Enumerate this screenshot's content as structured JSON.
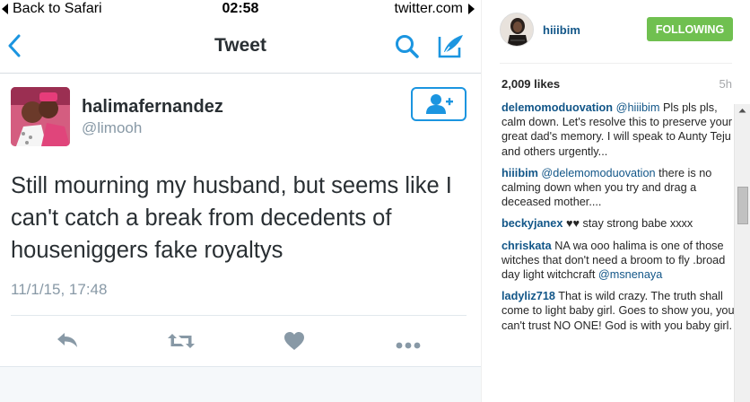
{
  "status_bar": {
    "back_label": "Back to Safari",
    "time": "02:58",
    "site": "twitter.com"
  },
  "nav": {
    "title": "Tweet",
    "back_icon": "chevron-left-icon",
    "search_icon": "search-icon",
    "compose_icon": "compose-icon"
  },
  "tweet": {
    "display_name": "halimafernandez",
    "handle": "@limooh",
    "text": "Still mourning my husband, but seems like I can't catch a break from decedents of houseniggers fake royaltys",
    "date": "11/1/15, 17:48",
    "follow_icon": "add-user-icon",
    "actions": [
      "reply-icon",
      "retweet-icon",
      "like-icon",
      "more-icon"
    ]
  },
  "instagram": {
    "username": "hiiibim",
    "follow_label": "FOLLOWING",
    "likes": "2,009 likes",
    "time": "5h",
    "comments": [
      {
        "user": "delemomoduovation",
        "mention": "@hiiibim",
        "text": " Pls pls pls, calm down. Let's resolve this to preserve your great dad's memory. I will speak to Aunty Teju and others urgently..."
      },
      {
        "user": "hiiibim",
        "mention": "@delemomoduovation",
        "text": " there is no calming down when you try and drag a deceased mother...."
      },
      {
        "user": "beckyjanex",
        "mention": "",
        "text": " ♥♥ stay strong babe xxxx"
      },
      {
        "user": "chriskata",
        "mention": "",
        "text": " NA wa ooo halima is one of those witches that don't need a broom to fly .broad day light witchcraft ",
        "trailing_mention": "@msnenaya"
      },
      {
        "user": "ladyliz718",
        "mention": "",
        "text": " That is wild crazy. The truth shall come to light baby girl. Goes to show you, you can't trust NO ONE! God is with you baby girl."
      }
    ]
  },
  "colors": {
    "twitter_blue": "#1b95e0",
    "twitter_gray": "#8899a6",
    "ig_link": "#125688",
    "ig_following_green": "#70c050"
  }
}
